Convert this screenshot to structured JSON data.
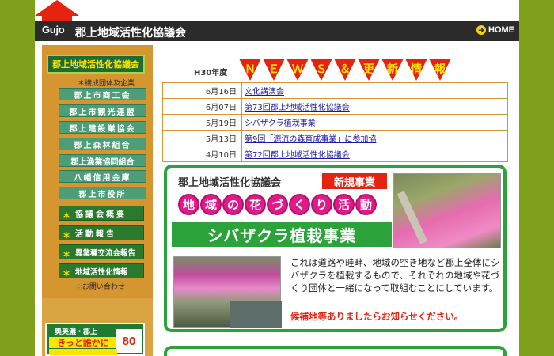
{
  "header": {
    "logo": "Gujo",
    "title": "郡上地域活性化協議会",
    "home_label": "HOME",
    "home_icon": "arrow-right-circle-icon"
  },
  "sidebar": {
    "org_badge": "郡上地域活性化協議会",
    "members_note": "＊構成団体及企業",
    "members": [
      "郡上市商工会",
      "郡上市観光連盟",
      "郡上建設業協会",
      "郡上森林組合",
      "郡上漁業協同組合",
      "八幡信用金庫",
      "郡上市役所"
    ],
    "menu": [
      "協議会概要",
      "活動報告",
      "異業種交流会報告",
      "地域活性化情報"
    ],
    "contact": "お問い合わせ",
    "banner": {
      "line1": "奥美濃・郡上",
      "line2": "きっと誰かに",
      "badge": "80"
    }
  },
  "news": {
    "year_label": "H30年度",
    "heading_letters": [
      "Ｎ",
      "Ｅ",
      "Ｗ",
      "Ｓ",
      "＆",
      "更",
      "新",
      "情",
      "報"
    ],
    "items": [
      {
        "date": "6月16日",
        "title": "文化講演会"
      },
      {
        "date": "6月07日",
        "title": "第73回郡上地域活性化協議会"
      },
      {
        "date": "5月19日",
        "title": "シバザクラ植栽事業"
      },
      {
        "date": "5月13日",
        "title": "第9回「源流の森育成事業」に参加協"
      },
      {
        "date": "4月10日",
        "title": "第72回郡上地域活性化協議会"
      }
    ]
  },
  "promo": {
    "council": "郡上地域活性化協議会",
    "new_badge": "新規事業",
    "flower_chars": [
      "地",
      "域",
      "の",
      "花",
      "づ",
      "く",
      "り",
      "活",
      "動"
    ],
    "main_title": "シバザクラ植栽事業",
    "text": "これは道路や畦畔、地域の空き地など郡上全体にシバザクラを植栽するもので、それぞれの地域や花づくり団体と一緒になって取組むことにしています。",
    "cta": "候補地等ありましたらお知らせください。"
  },
  "colors": {
    "background": "#7fa01a",
    "accent_red": "#e62310",
    "green": "#2ca33a",
    "sidebar_orange": "#d59630"
  }
}
